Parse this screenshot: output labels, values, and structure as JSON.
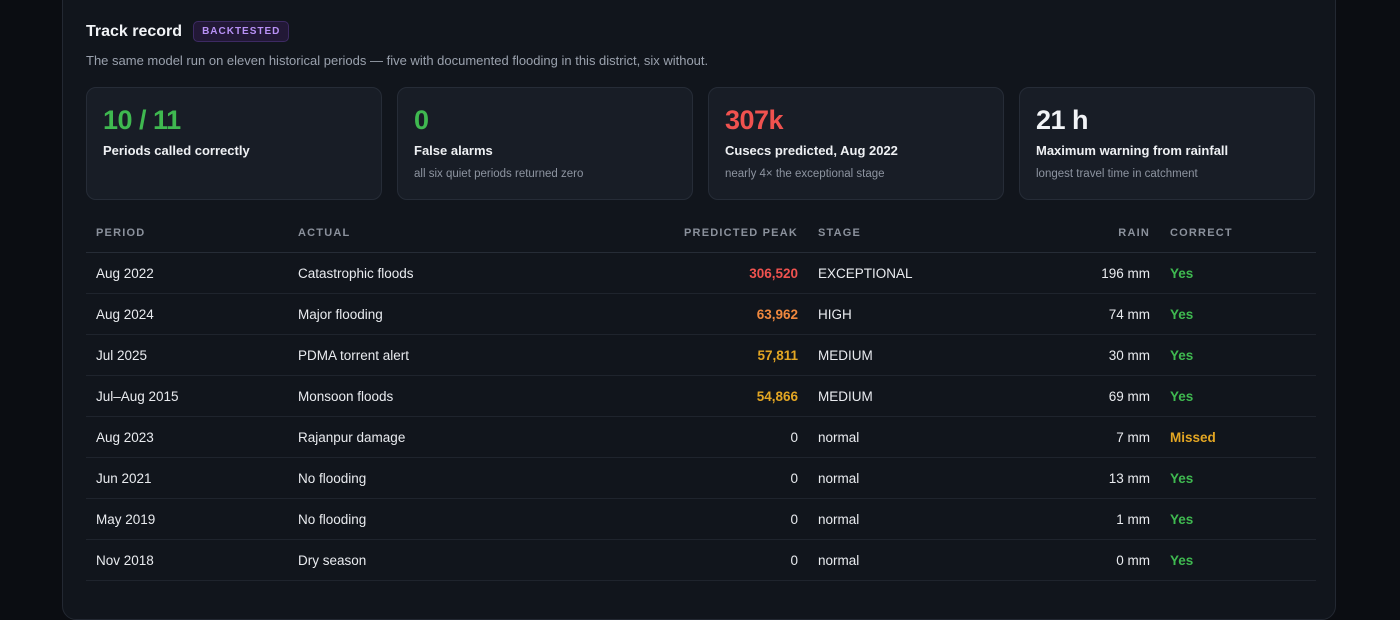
{
  "header": {
    "title": "Track record",
    "badge": "BACKTESTED",
    "subtitle": "The same model run on eleven historical periods — five with documented flooding in this district, six without."
  },
  "cards": [
    {
      "value": "10 / 11",
      "label": "Periods called correctly",
      "note": "",
      "color": "#3fb950"
    },
    {
      "value": "0",
      "label": "False alarms",
      "note": "all six quiet periods returned zero",
      "color": "#3fb950"
    },
    {
      "value": "307k",
      "label": "Cusecs predicted, Aug 2022",
      "note": "nearly 4× the exceptional stage",
      "color": "#f0524f"
    },
    {
      "value": "21 h",
      "label": "Maximum warning from rainfall",
      "note": "longest travel time in catchment",
      "color": "#f2f4f7"
    }
  ],
  "table": {
    "columns": [
      "PERIOD",
      "ACTUAL",
      "PREDICTED PEAK",
      "STAGE",
      "RAIN",
      "CORRECT"
    ],
    "rows": [
      {
        "period": "Aug 2022",
        "actual": "Catastrophic floods",
        "peak": "306,520",
        "peak_color": "#f0524f",
        "stage": "EXCEPTIONAL",
        "rain": "196 mm",
        "correct": "Yes"
      },
      {
        "period": "Aug 2024",
        "actual": "Major flooding",
        "peak": "63,962",
        "peak_color": "#f0883e",
        "stage": "HIGH",
        "rain": "74 mm",
        "correct": "Yes"
      },
      {
        "period": "Jul 2025",
        "actual": "PDMA torrent alert",
        "peak": "57,811",
        "peak_color": "#e3a623",
        "stage": "MEDIUM",
        "rain": "30 mm",
        "correct": "Yes"
      },
      {
        "period": "Jul–Aug 2015",
        "actual": "Monsoon floods",
        "peak": "54,866",
        "peak_color": "#e3a623",
        "stage": "MEDIUM",
        "rain": "69 mm",
        "correct": "Yes"
      },
      {
        "period": "Aug 2023",
        "actual": "Rajanpur damage",
        "peak": "0",
        "peak_color": "",
        "stage": "normal",
        "rain": "7 mm",
        "correct": "Missed"
      },
      {
        "period": "Jun 2021",
        "actual": "No flooding",
        "peak": "0",
        "peak_color": "",
        "stage": "normal",
        "rain": "13 mm",
        "correct": "Yes"
      },
      {
        "period": "May 2019",
        "actual": "No flooding",
        "peak": "0",
        "peak_color": "",
        "stage": "normal",
        "rain": "1 mm",
        "correct": "Yes"
      },
      {
        "period": "Nov 2018",
        "actual": "Dry season",
        "peak": "0",
        "peak_color": "",
        "stage": "normal",
        "rain": "0 mm",
        "correct": "Yes"
      }
    ]
  }
}
